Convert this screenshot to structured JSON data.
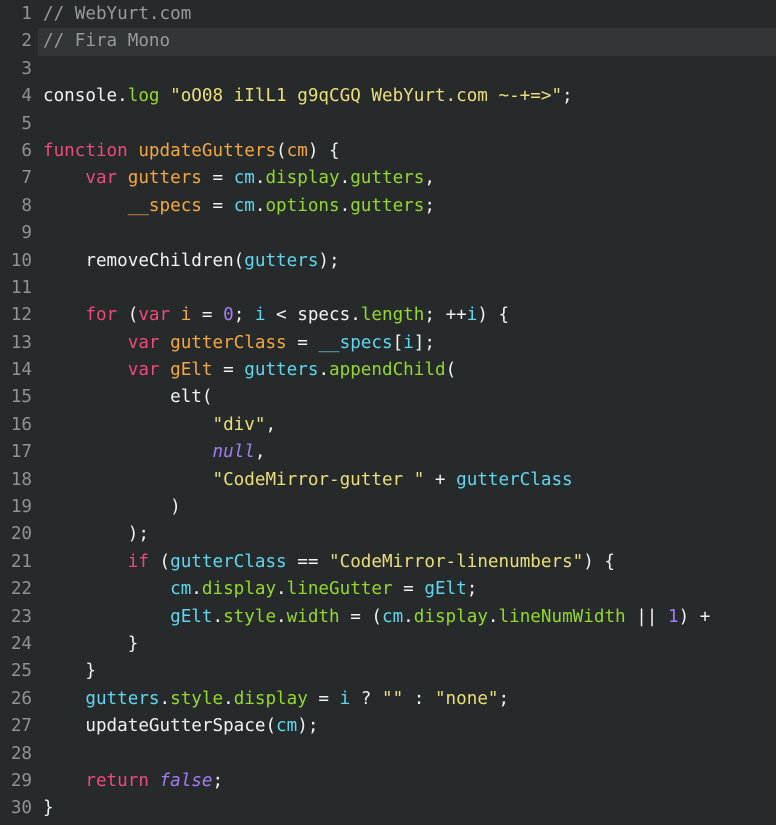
{
  "editor": {
    "name": "code-editor",
    "background": "#272a2b",
    "gutter_color": "#8d9396",
    "active_line_number": 2,
    "active_line_background": "#333637",
    "total_lines": 30,
    "font_sample_label": "Fira Mono",
    "theme_colors": {
      "plain": "#f2f2f2",
      "comment": "#9a9a9a",
      "keyword": "#f0497b",
      "function": "#f5a742",
      "variable": "#f5a742",
      "string": "#ecdf7a",
      "property": "#94d82d",
      "object": "#5fd7f0",
      "number": "#a77bf3",
      "constant": "#a77bf3"
    }
  },
  "lines": [
    {
      "n": "1",
      "tokens": [
        {
          "c": "t-comment",
          "t": "// WebYurt.com"
        }
      ]
    },
    {
      "n": "2",
      "tokens": [
        {
          "c": "t-comment",
          "t": "// Fira Mono"
        }
      ]
    },
    {
      "n": "3",
      "tokens": []
    },
    {
      "n": "4",
      "tokens": [
        {
          "c": "t-plain",
          "t": "console"
        },
        {
          "c": "t-punc",
          "t": "."
        },
        {
          "c": "t-method",
          "t": "log"
        },
        {
          "c": "t-plain",
          "t": " "
        },
        {
          "c": "t-string",
          "t": "\"oO08 iIlL1 g9qCGQ WebYurt.com ~-+=>\""
        },
        {
          "c": "t-punc",
          "t": ";"
        }
      ]
    },
    {
      "n": "5",
      "tokens": []
    },
    {
      "n": "6",
      "tokens": [
        {
          "c": "t-keyword",
          "t": "function"
        },
        {
          "c": "t-plain",
          "t": " "
        },
        {
          "c": "t-func",
          "t": "updateGutters"
        },
        {
          "c": "t-punc",
          "t": "("
        },
        {
          "c": "t-param",
          "t": "cm"
        },
        {
          "c": "t-punc",
          "t": ") {"
        }
      ]
    },
    {
      "n": "7",
      "tokens": [
        {
          "c": "t-plain",
          "t": "    "
        },
        {
          "c": "t-keyword",
          "t": "var"
        },
        {
          "c": "t-plain",
          "t": " "
        },
        {
          "c": "t-var",
          "t": "gutters"
        },
        {
          "c": "t-op",
          "t": " = "
        },
        {
          "c": "t-obj",
          "t": "cm"
        },
        {
          "c": "t-punc",
          "t": "."
        },
        {
          "c": "t-prop",
          "t": "display"
        },
        {
          "c": "t-punc",
          "t": "."
        },
        {
          "c": "t-prop",
          "t": "gutters"
        },
        {
          "c": "t-punc",
          "t": ","
        }
      ]
    },
    {
      "n": "8",
      "tokens": [
        {
          "c": "t-plain",
          "t": "        "
        },
        {
          "c": "t-var",
          "t": "__specs"
        },
        {
          "c": "t-op",
          "t": " = "
        },
        {
          "c": "t-obj",
          "t": "cm"
        },
        {
          "c": "t-punc",
          "t": "."
        },
        {
          "c": "t-prop",
          "t": "options"
        },
        {
          "c": "t-punc",
          "t": "."
        },
        {
          "c": "t-prop",
          "t": "gutters"
        },
        {
          "c": "t-punc",
          "t": ";"
        }
      ]
    },
    {
      "n": "9",
      "tokens": []
    },
    {
      "n": "10",
      "tokens": [
        {
          "c": "t-plain",
          "t": "    removeChildren"
        },
        {
          "c": "t-punc",
          "t": "("
        },
        {
          "c": "t-ident",
          "t": "gutters"
        },
        {
          "c": "t-punc",
          "t": ");"
        }
      ]
    },
    {
      "n": "11",
      "tokens": []
    },
    {
      "n": "12",
      "tokens": [
        {
          "c": "t-plain",
          "t": "    "
        },
        {
          "c": "t-keyword",
          "t": "for"
        },
        {
          "c": "t-plain",
          "t": " "
        },
        {
          "c": "t-punc",
          "t": "("
        },
        {
          "c": "t-keyword",
          "t": "var"
        },
        {
          "c": "t-plain",
          "t": " "
        },
        {
          "c": "t-var",
          "t": "i"
        },
        {
          "c": "t-op",
          "t": " = "
        },
        {
          "c": "t-number",
          "t": "0"
        },
        {
          "c": "t-punc",
          "t": "; "
        },
        {
          "c": "t-ident",
          "t": "i"
        },
        {
          "c": "t-op",
          "t": " < "
        },
        {
          "c": "t-plain",
          "t": "specs"
        },
        {
          "c": "t-punc",
          "t": "."
        },
        {
          "c": "t-prop",
          "t": "length"
        },
        {
          "c": "t-punc",
          "t": "; "
        },
        {
          "c": "t-op",
          "t": "++"
        },
        {
          "c": "t-ident",
          "t": "i"
        },
        {
          "c": "t-punc",
          "t": ") {"
        }
      ]
    },
    {
      "n": "13",
      "tokens": [
        {
          "c": "t-plain",
          "t": "        "
        },
        {
          "c": "t-keyword",
          "t": "var"
        },
        {
          "c": "t-plain",
          "t": " "
        },
        {
          "c": "t-var",
          "t": "gutterClass"
        },
        {
          "c": "t-op",
          "t": " = "
        },
        {
          "c": "t-ident",
          "t": "__specs"
        },
        {
          "c": "t-punc",
          "t": "["
        },
        {
          "c": "t-ident",
          "t": "i"
        },
        {
          "c": "t-punc",
          "t": "];"
        }
      ]
    },
    {
      "n": "14",
      "tokens": [
        {
          "c": "t-plain",
          "t": "        "
        },
        {
          "c": "t-keyword",
          "t": "var"
        },
        {
          "c": "t-plain",
          "t": " "
        },
        {
          "c": "t-var",
          "t": "gElt"
        },
        {
          "c": "t-op",
          "t": " = "
        },
        {
          "c": "t-ident",
          "t": "gutters"
        },
        {
          "c": "t-punc",
          "t": "."
        },
        {
          "c": "t-method",
          "t": "appendChild"
        },
        {
          "c": "t-punc",
          "t": "("
        }
      ]
    },
    {
      "n": "15",
      "tokens": [
        {
          "c": "t-plain",
          "t": "            elt"
        },
        {
          "c": "t-punc",
          "t": "("
        }
      ]
    },
    {
      "n": "16",
      "tokens": [
        {
          "c": "t-plain",
          "t": "                "
        },
        {
          "c": "t-string",
          "t": "\"div\""
        },
        {
          "c": "t-punc",
          "t": ","
        }
      ]
    },
    {
      "n": "17",
      "tokens": [
        {
          "c": "t-plain",
          "t": "                "
        },
        {
          "c": "t-const",
          "t": "null"
        },
        {
          "c": "t-punc",
          "t": ","
        }
      ]
    },
    {
      "n": "18",
      "tokens": [
        {
          "c": "t-plain",
          "t": "                "
        },
        {
          "c": "t-string",
          "t": "\"CodeMirror-gutter \""
        },
        {
          "c": "t-op",
          "t": " + "
        },
        {
          "c": "t-ident",
          "t": "gutterClass"
        }
      ]
    },
    {
      "n": "19",
      "tokens": [
        {
          "c": "t-punc",
          "t": "            )"
        }
      ]
    },
    {
      "n": "20",
      "tokens": [
        {
          "c": "t-punc",
          "t": "        );"
        }
      ]
    },
    {
      "n": "21",
      "tokens": [
        {
          "c": "t-plain",
          "t": "        "
        },
        {
          "c": "t-keyword",
          "t": "if"
        },
        {
          "c": "t-plain",
          "t": " "
        },
        {
          "c": "t-punc",
          "t": "("
        },
        {
          "c": "t-ident",
          "t": "gutterClass"
        },
        {
          "c": "t-op",
          "t": " == "
        },
        {
          "c": "t-string",
          "t": "\"CodeMirror-linenumbers\""
        },
        {
          "c": "t-punc",
          "t": ") {"
        }
      ]
    },
    {
      "n": "22",
      "tokens": [
        {
          "c": "t-plain",
          "t": "            "
        },
        {
          "c": "t-obj",
          "t": "cm"
        },
        {
          "c": "t-punc",
          "t": "."
        },
        {
          "c": "t-prop",
          "t": "display"
        },
        {
          "c": "t-punc",
          "t": "."
        },
        {
          "c": "t-prop",
          "t": "lineGutter"
        },
        {
          "c": "t-op",
          "t": " = "
        },
        {
          "c": "t-ident",
          "t": "gElt"
        },
        {
          "c": "t-punc",
          "t": ";"
        }
      ]
    },
    {
      "n": "23",
      "tokens": [
        {
          "c": "t-plain",
          "t": "            "
        },
        {
          "c": "t-obj",
          "t": "gElt"
        },
        {
          "c": "t-punc",
          "t": "."
        },
        {
          "c": "t-prop",
          "t": "style"
        },
        {
          "c": "t-punc",
          "t": "."
        },
        {
          "c": "t-prop",
          "t": "width"
        },
        {
          "c": "t-op",
          "t": " = "
        },
        {
          "c": "t-punc",
          "t": "("
        },
        {
          "c": "t-obj",
          "t": "cm"
        },
        {
          "c": "t-punc",
          "t": "."
        },
        {
          "c": "t-prop",
          "t": "display"
        },
        {
          "c": "t-punc",
          "t": "."
        },
        {
          "c": "t-prop",
          "t": "lineNumWidth"
        },
        {
          "c": "t-op",
          "t": " || "
        },
        {
          "c": "t-number",
          "t": "1"
        },
        {
          "c": "t-punc",
          "t": ")"
        },
        {
          "c": "t-op",
          "t": " +"
        }
      ]
    },
    {
      "n": "24",
      "tokens": [
        {
          "c": "t-punc",
          "t": "        }"
        }
      ]
    },
    {
      "n": "25",
      "tokens": [
        {
          "c": "t-punc",
          "t": "    }"
        }
      ]
    },
    {
      "n": "26",
      "tokens": [
        {
          "c": "t-plain",
          "t": "    "
        },
        {
          "c": "t-obj",
          "t": "gutters"
        },
        {
          "c": "t-punc",
          "t": "."
        },
        {
          "c": "t-prop",
          "t": "style"
        },
        {
          "c": "t-punc",
          "t": "."
        },
        {
          "c": "t-prop",
          "t": "display"
        },
        {
          "c": "t-op",
          "t": " = "
        },
        {
          "c": "t-ident",
          "t": "i"
        },
        {
          "c": "t-op",
          "t": " ? "
        },
        {
          "c": "t-string",
          "t": "\"\""
        },
        {
          "c": "t-op",
          "t": " : "
        },
        {
          "c": "t-string",
          "t": "\"none\""
        },
        {
          "c": "t-punc",
          "t": ";"
        }
      ]
    },
    {
      "n": "27",
      "tokens": [
        {
          "c": "t-plain",
          "t": "    updateGutterSpace"
        },
        {
          "c": "t-punc",
          "t": "("
        },
        {
          "c": "t-ident",
          "t": "cm"
        },
        {
          "c": "t-punc",
          "t": ");"
        }
      ]
    },
    {
      "n": "28",
      "tokens": []
    },
    {
      "n": "29",
      "tokens": [
        {
          "c": "t-plain",
          "t": "    "
        },
        {
          "c": "t-keyword",
          "t": "return"
        },
        {
          "c": "t-plain",
          "t": " "
        },
        {
          "c": "t-const",
          "t": "false"
        },
        {
          "c": "t-punc",
          "t": ";"
        }
      ]
    },
    {
      "n": "30",
      "tokens": [
        {
          "c": "t-punc",
          "t": "}"
        }
      ]
    }
  ]
}
